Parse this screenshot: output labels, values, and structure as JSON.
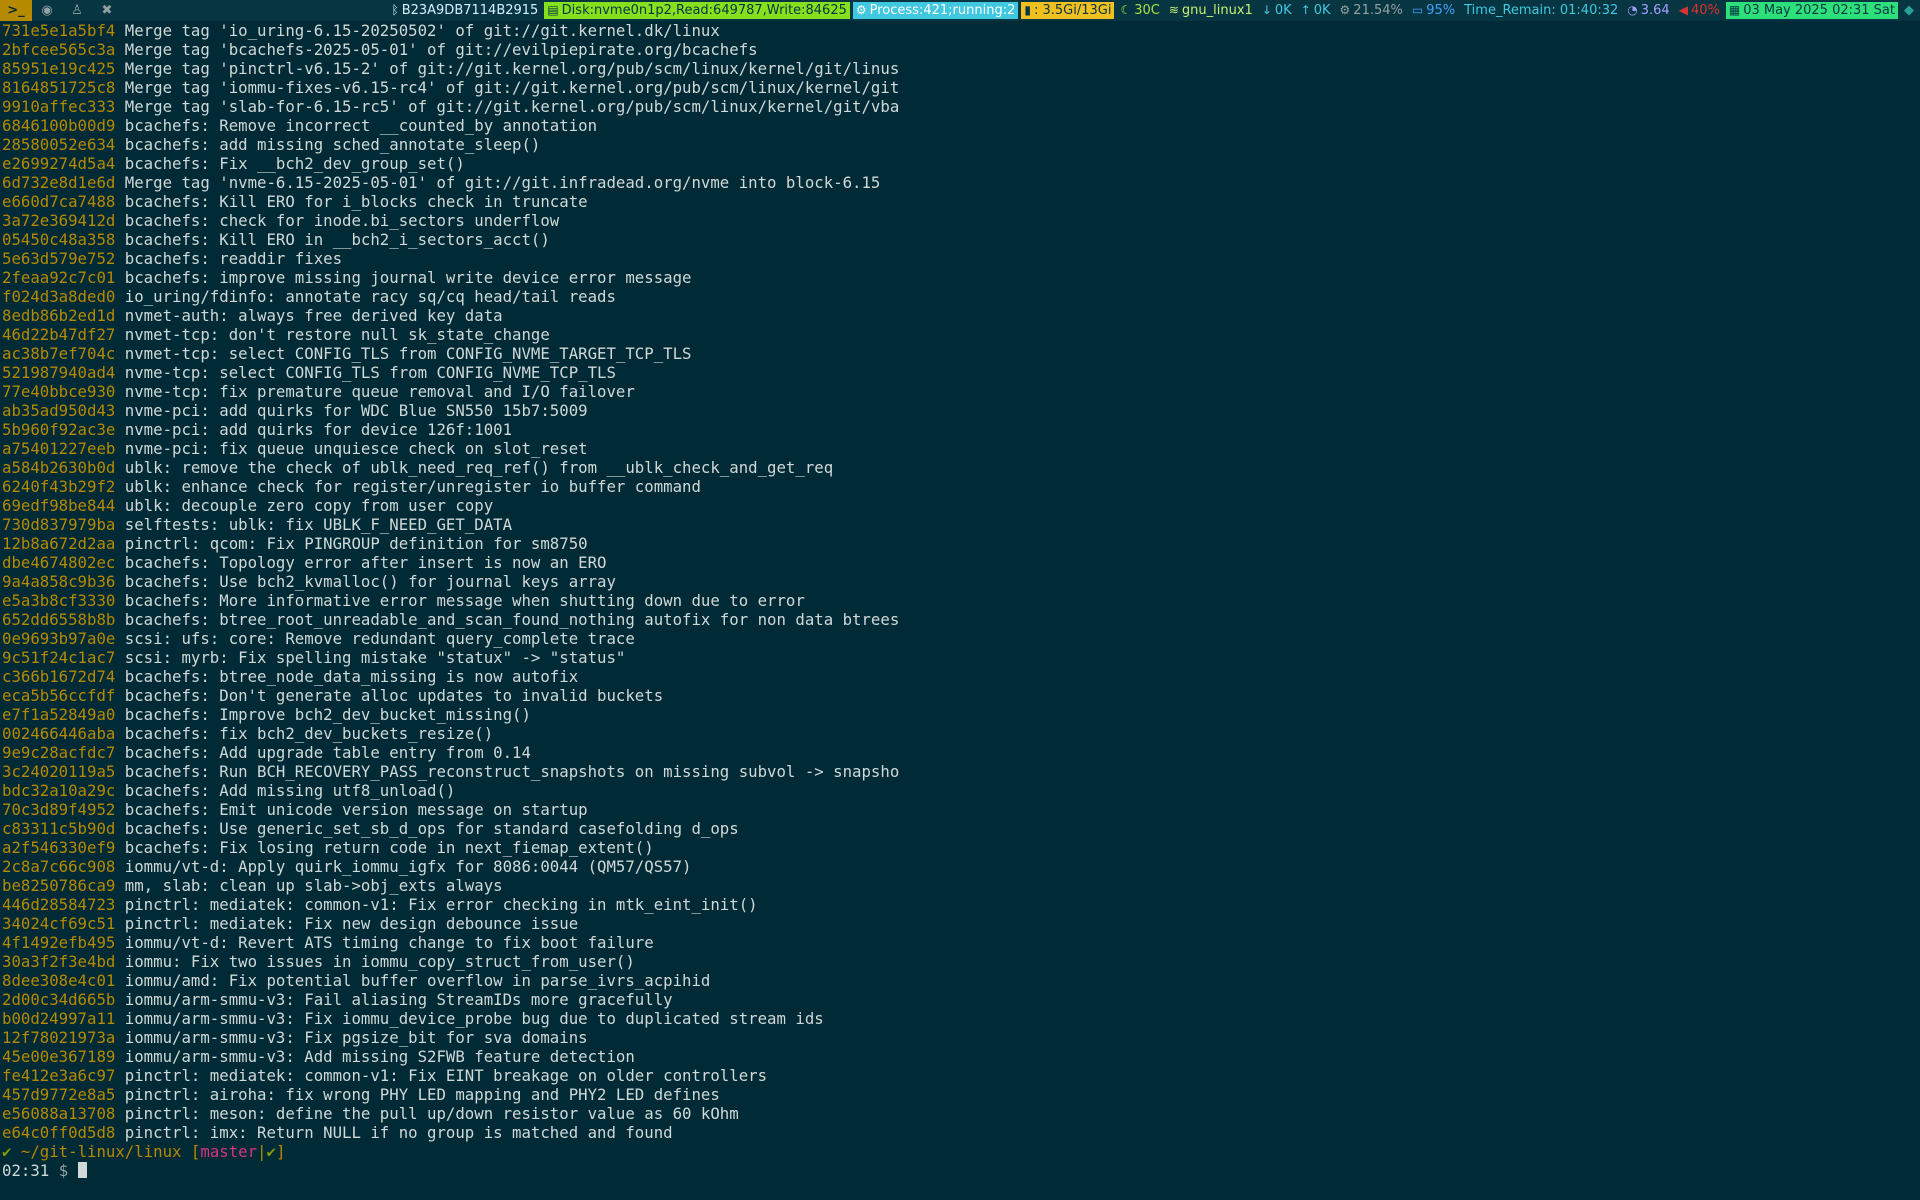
{
  "topbar": {
    "left_icons": [
      "terminal-icon",
      "firefox-icon",
      "linux-icon",
      "tools-icon"
    ],
    "segments": {
      "bluetooth": "B23A9DB7114B2915",
      "disk": "Disk:nvme0n1p2,Read:649787,Write:84625",
      "process": "Process:421;running:2",
      "memory": ": 3.5Gi/13Gi",
      "temp": "30C",
      "wifi": "gnu_linux1",
      "net_down": "0K",
      "net_up": "0K",
      "cpu": "21.54%",
      "battery": "95%",
      "time_remain": "Time_Remain: 01:40:32",
      "load": "3.64",
      "volume": "40%",
      "date": "03 May 2025 02:31 Sat"
    }
  },
  "terminal": {
    "lines": [
      {
        "hash": "731e5e1a5bf4",
        "msg": "Merge tag 'io_uring-6.15-20250502' of git://git.kernel.dk/linux"
      },
      {
        "hash": "2bfcee565c3a",
        "msg": "Merge tag 'bcachefs-2025-05-01' of git://evilpiepirate.org/bcachefs"
      },
      {
        "hash": "85951e19c425",
        "msg": "Merge tag 'pinctrl-v6.15-2' of git://git.kernel.org/pub/scm/linux/kernel/git/linus"
      },
      {
        "hash": "8164851725c8",
        "msg": "Merge tag 'iommu-fixes-v6.15-rc4' of git://git.kernel.org/pub/scm/linux/kernel/git"
      },
      {
        "hash": "9910affec333",
        "msg": "Merge tag 'slab-for-6.15-rc5' of git://git.kernel.org/pub/scm/linux/kernel/git/vba"
      },
      {
        "hash": "6846100b00d9",
        "msg": "bcachefs: Remove incorrect __counted_by annotation"
      },
      {
        "hash": "28580052e634",
        "msg": "bcachefs: add missing sched_annotate_sleep()"
      },
      {
        "hash": "e2699274d5a4",
        "msg": "bcachefs: Fix __bch2_dev_group_set()"
      },
      {
        "hash": "6d732e8d1e6d",
        "msg": "Merge tag 'nvme-6.15-2025-05-01' of git://git.infradead.org/nvme into block-6.15"
      },
      {
        "hash": "e660d7ca7488",
        "msg": "bcachefs: Kill ERO for i_blocks check in truncate"
      },
      {
        "hash": "3a72e369412d",
        "msg": "bcachefs: check for inode.bi_sectors underflow"
      },
      {
        "hash": "05450c48a358",
        "msg": "bcachefs: Kill ERO in __bch2_i_sectors_acct()"
      },
      {
        "hash": "5e63d579e752",
        "msg": "bcachefs: readdir fixes"
      },
      {
        "hash": "2feaa92c7c01",
        "msg": "bcachefs: improve missing journal write device error message"
      },
      {
        "hash": "f024d3a8ded0",
        "msg": "io_uring/fdinfo: annotate racy sq/cq head/tail reads"
      },
      {
        "hash": "8edb86b2ed1d",
        "msg": "nvmet-auth: always free derived key data"
      },
      {
        "hash": "46d22b47df27",
        "msg": "nvmet-tcp: don't restore null sk_state_change"
      },
      {
        "hash": "ac38b7ef704c",
        "msg": "nvmet-tcp: select CONFIG_TLS from CONFIG_NVME_TARGET_TCP_TLS"
      },
      {
        "hash": "521987940ad4",
        "msg": "nvme-tcp: select CONFIG_TLS from CONFIG_NVME_TCP_TLS"
      },
      {
        "hash": "77e40bbce930",
        "msg": "nvme-tcp: fix premature queue removal and I/O failover"
      },
      {
        "hash": "ab35ad950d43",
        "msg": "nvme-pci: add quirks for WDC Blue SN550 15b7:5009"
      },
      {
        "hash": "5b960f92ac3e",
        "msg": "nvme-pci: add quirks for device 126f:1001"
      },
      {
        "hash": "a75401227eeb",
        "msg": "nvme-pci: fix queue unquiesce check on slot_reset"
      },
      {
        "hash": "a584b2630b0d",
        "msg": "ublk: remove the check of ublk_need_req_ref() from __ublk_check_and_get_req"
      },
      {
        "hash": "6240f43b29f2",
        "msg": "ublk: enhance check for register/unregister io buffer command"
      },
      {
        "hash": "69edf98be844",
        "msg": "ublk: decouple zero copy from user copy"
      },
      {
        "hash": "730d837979ba",
        "msg": "selftests: ublk: fix UBLK_F_NEED_GET_DATA"
      },
      {
        "hash": "12b8a672d2aa",
        "msg": "pinctrl: qcom: Fix PINGROUP definition for sm8750"
      },
      {
        "hash": "dbe4674802ec",
        "msg": "bcachefs: Topology error after insert is now an ERO"
      },
      {
        "hash": "9a4a858c9b36",
        "msg": "bcachefs: Use bch2_kvmalloc() for journal keys array"
      },
      {
        "hash": "e5a3b8cf3330",
        "msg": "bcachefs: More informative error message when shutting down due to error"
      },
      {
        "hash": "652dd6558b8b",
        "msg": "bcachefs: btree_root_unreadable_and_scan_found_nothing autofix for non data btrees"
      },
      {
        "hash": "0e9693b97a0e",
        "msg": "scsi: ufs: core: Remove redundant query_complete trace"
      },
      {
        "hash": "9c51f24c1ac7",
        "msg": "scsi: myrb: Fix spelling mistake \"statux\" -> \"status\""
      },
      {
        "hash": "c366b1672d74",
        "msg": "bcachefs: btree_node_data_missing is now autofix"
      },
      {
        "hash": "eca5b56ccfdf",
        "msg": "bcachefs: Don't generate alloc updates to invalid buckets"
      },
      {
        "hash": "e7f1a52849a0",
        "msg": "bcachefs: Improve bch2_dev_bucket_missing()"
      },
      {
        "hash": "002466446aba",
        "msg": "bcachefs: fix bch2_dev_buckets_resize()"
      },
      {
        "hash": "9e9c28acfdc7",
        "msg": "bcachefs: Add upgrade table entry from 0.14"
      },
      {
        "hash": "3c24020119a5",
        "msg": "bcachefs: Run BCH_RECOVERY_PASS_reconstruct_snapshots on missing subvol -> snapsho"
      },
      {
        "hash": "bdc32a10a29c",
        "msg": "bcachefs: Add missing utf8_unload()"
      },
      {
        "hash": "70c3d89f4952",
        "msg": "bcachefs: Emit unicode version message on startup"
      },
      {
        "hash": "c83311c5b90d",
        "msg": "bcachefs: Use generic_set_sb_d_ops for standard casefolding d_ops"
      },
      {
        "hash": "a2f546330ef9",
        "msg": "bcachefs: Fix losing return code in next_fiemap_extent()"
      },
      {
        "hash": "2c8a7c66c908",
        "msg": "iommu/vt-d: Apply quirk_iommu_igfx for 8086:0044 (QM57/QS57)"
      },
      {
        "hash": "be8250786ca9",
        "msg": "mm, slab: clean up slab->obj_exts always"
      },
      {
        "hash": "446d28584723",
        "msg": "pinctrl: mediatek: common-v1: Fix error checking in mtk_eint_init()"
      },
      {
        "hash": "34024cf69c51",
        "msg": "pinctrl: mediatek: Fix new design debounce issue"
      },
      {
        "hash": "4f1492efb495",
        "msg": "iommu/vt-d: Revert ATS timing change to fix boot failure"
      },
      {
        "hash": "30a3f2f3e4bd",
        "msg": "iommu: Fix two issues in iommu_copy_struct_from_user()"
      },
      {
        "hash": "8dee308e4c01",
        "msg": "iommu/amd: Fix potential buffer overflow in parse_ivrs_acpihid"
      },
      {
        "hash": "2d00c34d665b",
        "msg": "iommu/arm-smmu-v3: Fail aliasing StreamIDs more gracefully"
      },
      {
        "hash": "b00d24997a11",
        "msg": "iommu/arm-smmu-v3: Fix iommu_device_probe bug due to duplicated stream ids"
      },
      {
        "hash": "12f78021973a",
        "msg": "iommu/arm-smmu-v3: Fix pgsize_bit for sva domains"
      },
      {
        "hash": "45e00e367189",
        "msg": "iommu/arm-smmu-v3: Add missing S2FWB feature detection"
      },
      {
        "hash": "fe412e3a6c97",
        "msg": "pinctrl: mediatek: common-v1: Fix EINT breakage on older controllers"
      },
      {
        "hash": "457d9772e8a5",
        "msg": "pinctrl: airoha: fix wrong PHY LED mapping and PHY2 LED defines"
      },
      {
        "hash": "e56088a13708",
        "msg": "pinctrl: meson: define the pull up/down resistor value as 60 kOhm"
      },
      {
        "hash": "e64c0ff0d5d8",
        "msg": "pinctrl: imx: Return NULL if no group is matched and found"
      }
    ],
    "prompt": {
      "check": "✔",
      "path": "~/git-linux/linux",
      "open_bracket": "[",
      "branch": "master",
      "separator": "|",
      "clean_mark": "✔",
      "close_bracket": "]",
      "time": "02:31",
      "symbol": "$"
    }
  },
  "colors": {
    "background": "#002b36",
    "hash": "#b58900",
    "text": "#d0d8d8",
    "branch": "#d33682",
    "check": "#859900"
  }
}
